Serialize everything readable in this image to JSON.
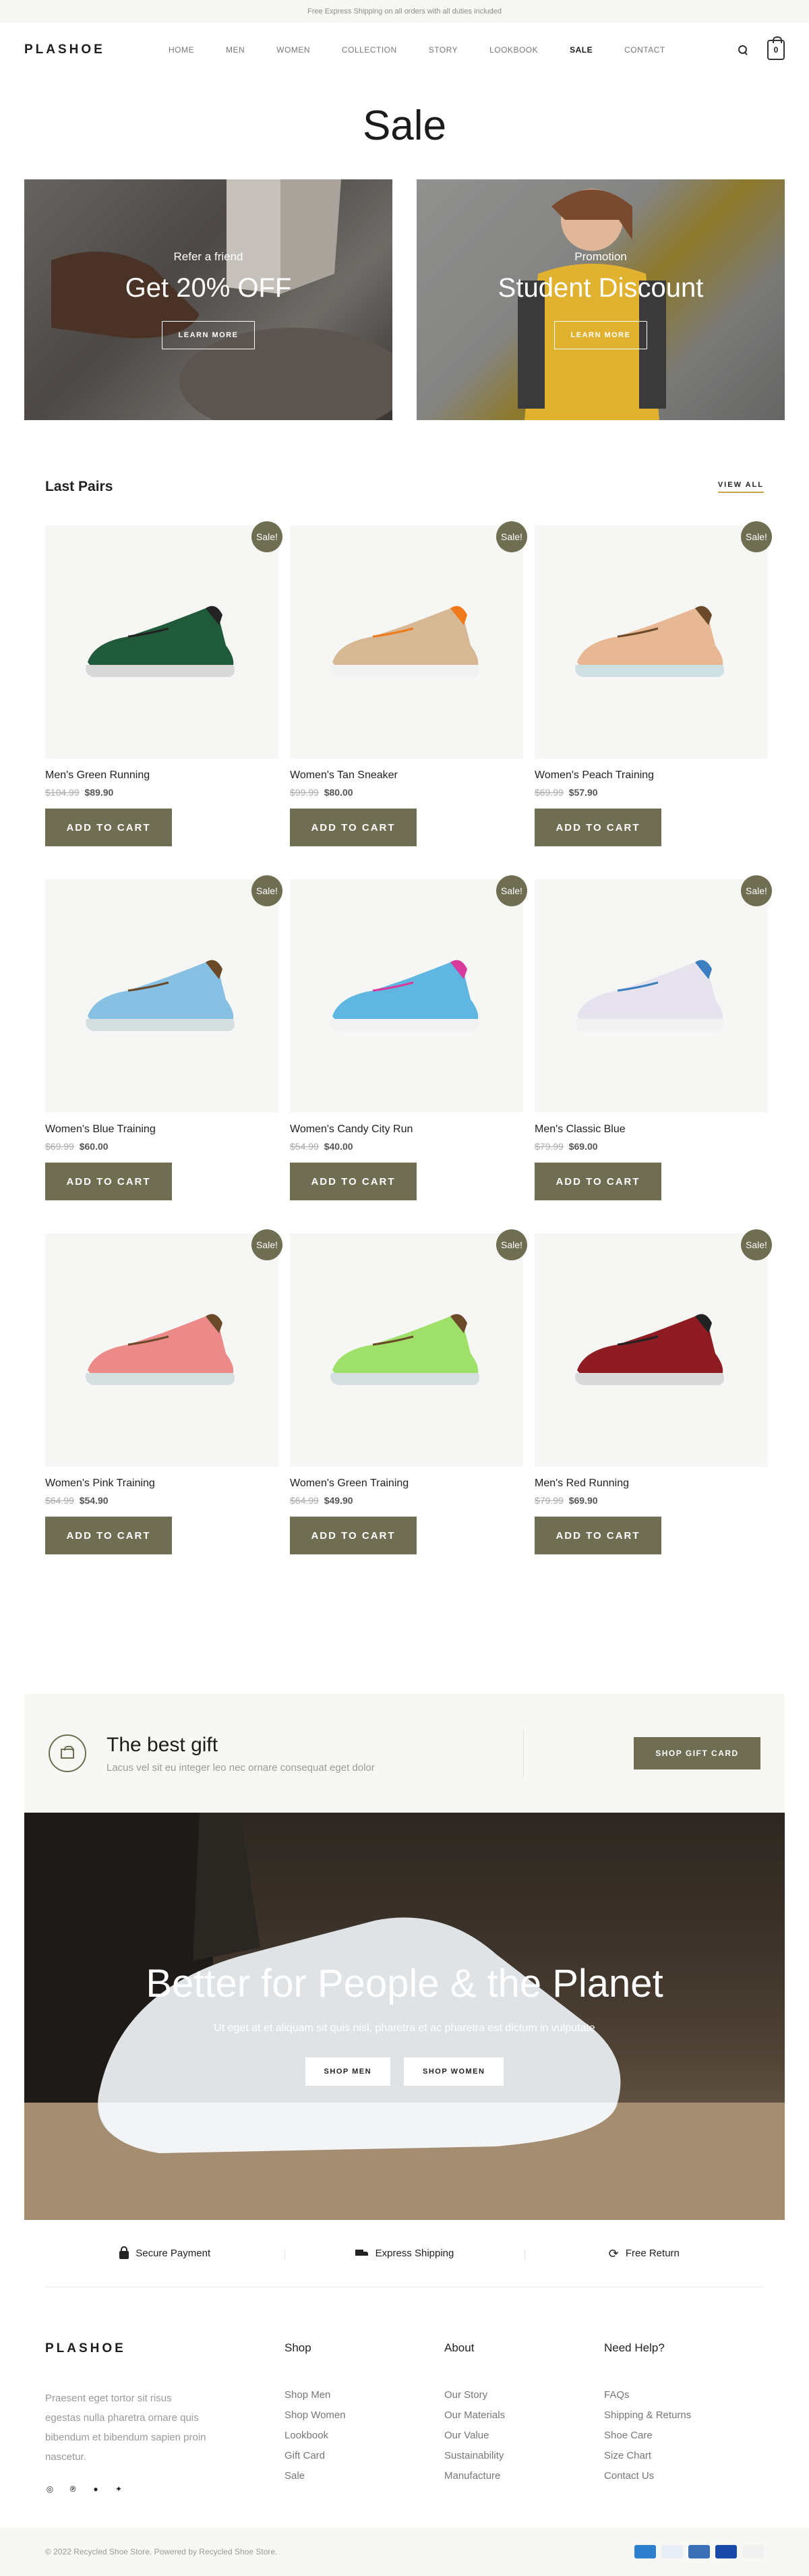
{
  "topbar": {
    "text": "Free Express Shipping on all orders with all duties included"
  },
  "header": {
    "logo": "PLASHOE",
    "nav": [
      "HOME",
      "MEN",
      "WOMEN",
      "COLLECTION",
      "STORY",
      "LOOKBOOK",
      "SALE",
      "CONTACT"
    ],
    "active_nav": "SALE",
    "cart_count": "0"
  },
  "page": {
    "title": "Sale"
  },
  "promos": [
    {
      "eyebrow": "Refer a friend",
      "title": "Get 20% OFF",
      "button": "LEARN MORE"
    },
    {
      "eyebrow": "Promotion",
      "title": "Student Discount",
      "button": "LEARN MORE"
    }
  ],
  "products_section": {
    "title": "Last Pairs",
    "view_all": "VIEW ALL",
    "badge": "Sale!",
    "add_to_cart": "ADD TO CART",
    "items": [
      {
        "name": "Men's Green Running",
        "old_price": "$104.99",
        "price": "$89.90",
        "color": "#1f5a3a",
        "sole": "#d9d9d9",
        "accent": "#222222"
      },
      {
        "name": "Women's Tan Sneaker",
        "old_price": "$99.99",
        "price": "$80.00",
        "color": "#d6b994",
        "sole": "#f2f2f2",
        "accent": "#f07a1a"
      },
      {
        "name": "Women's Peach Training",
        "old_price": "$69.99",
        "price": "$57.90",
        "color": "#e8b894",
        "sole": "#cfe0e2",
        "accent": "#6b4a2a"
      },
      {
        "name": "Women's Blue Training",
        "old_price": "$69.99",
        "price": "$60.00",
        "color": "#86c1e3",
        "sole": "#d5dfe0",
        "accent": "#6b4a2a"
      },
      {
        "name": "Women's Candy City Run",
        "old_price": "$54.99",
        "price": "$40.00",
        "color": "#5fb6e0",
        "sole": "#f2f2f2",
        "accent": "#d93b9c"
      },
      {
        "name": "Men's Classic Blue",
        "old_price": "$79.99",
        "price": "$69.00",
        "color": "#e6e3ef",
        "sole": "#f2f2f2",
        "accent": "#3b7fc0"
      },
      {
        "name": "Women's Pink Training",
        "old_price": "$64.99",
        "price": "$54.90",
        "color": "#ec8a8a",
        "sole": "#d5dfe0",
        "accent": "#6b4a2a"
      },
      {
        "name": "Women's Green Training",
        "old_price": "$64.99",
        "price": "$49.90",
        "color": "#9ee06a",
        "sole": "#d5dfe0",
        "accent": "#6b4a2a"
      },
      {
        "name": "Men's Red Running",
        "old_price": "$79.99",
        "price": "$69.90",
        "color": "#8e1c22",
        "sole": "#d9d9d9",
        "accent": "#222222"
      }
    ]
  },
  "gift": {
    "title": "The best gift",
    "subtitle": "Lacus vel sit eu integer leo nec ornare consequat eget dolor",
    "button": "SHOP GIFT CARD"
  },
  "hero": {
    "title": "Better for People & the Planet",
    "subtitle": "Ut eget at et aliquam sit quis nisl, pharetra et ac pharetra est dictum in vulputate",
    "buttons": [
      "SHOP MEN",
      "SHOP WOMEN"
    ]
  },
  "features": [
    {
      "icon": "lock-icon",
      "label": "Secure Payment"
    },
    {
      "icon": "truck-icon",
      "label": "Express Shipping"
    },
    {
      "icon": "refresh-icon",
      "label": "Free Return"
    }
  ],
  "footer": {
    "logo": "PLASHOE",
    "about": "Praesent eget tortor sit risus egestas nulla pharetra ornare quis bibendum et bibendum sapien proin nascetur.",
    "socials": [
      "instagram-icon",
      "pinterest-icon",
      "facebook-icon",
      "twitter-icon"
    ],
    "columns": [
      {
        "title": "Shop",
        "links": [
          "Shop Men",
          "Shop Women",
          "Lookbook",
          "Gift Card",
          "Sale"
        ]
      },
      {
        "title": "About",
        "links": [
          "Our Story",
          "Our Materials",
          "Our Value",
          "Sustainability",
          "Manufacture"
        ]
      },
      {
        "title": "Need Help?",
        "links": [
          "FAQs",
          "Shipping & Returns",
          "Shoe Care",
          "Size Chart",
          "Contact Us"
        ]
      }
    ],
    "copyright": "© 2022 Recycled Shoe Store. Powered by Recycled Shoe Store.",
    "payments": [
      {
        "name": "amex-icon",
        "color": "#2f7fd1"
      },
      {
        "name": "paypal-icon",
        "color": "#e9eef6"
      },
      {
        "name": "mastercard-generic-icon",
        "color": "#3a6fb5"
      },
      {
        "name": "visa-icon",
        "color": "#1a4aa8"
      },
      {
        "name": "mastercard-icon",
        "color": "#f1f1f1"
      }
    ]
  }
}
